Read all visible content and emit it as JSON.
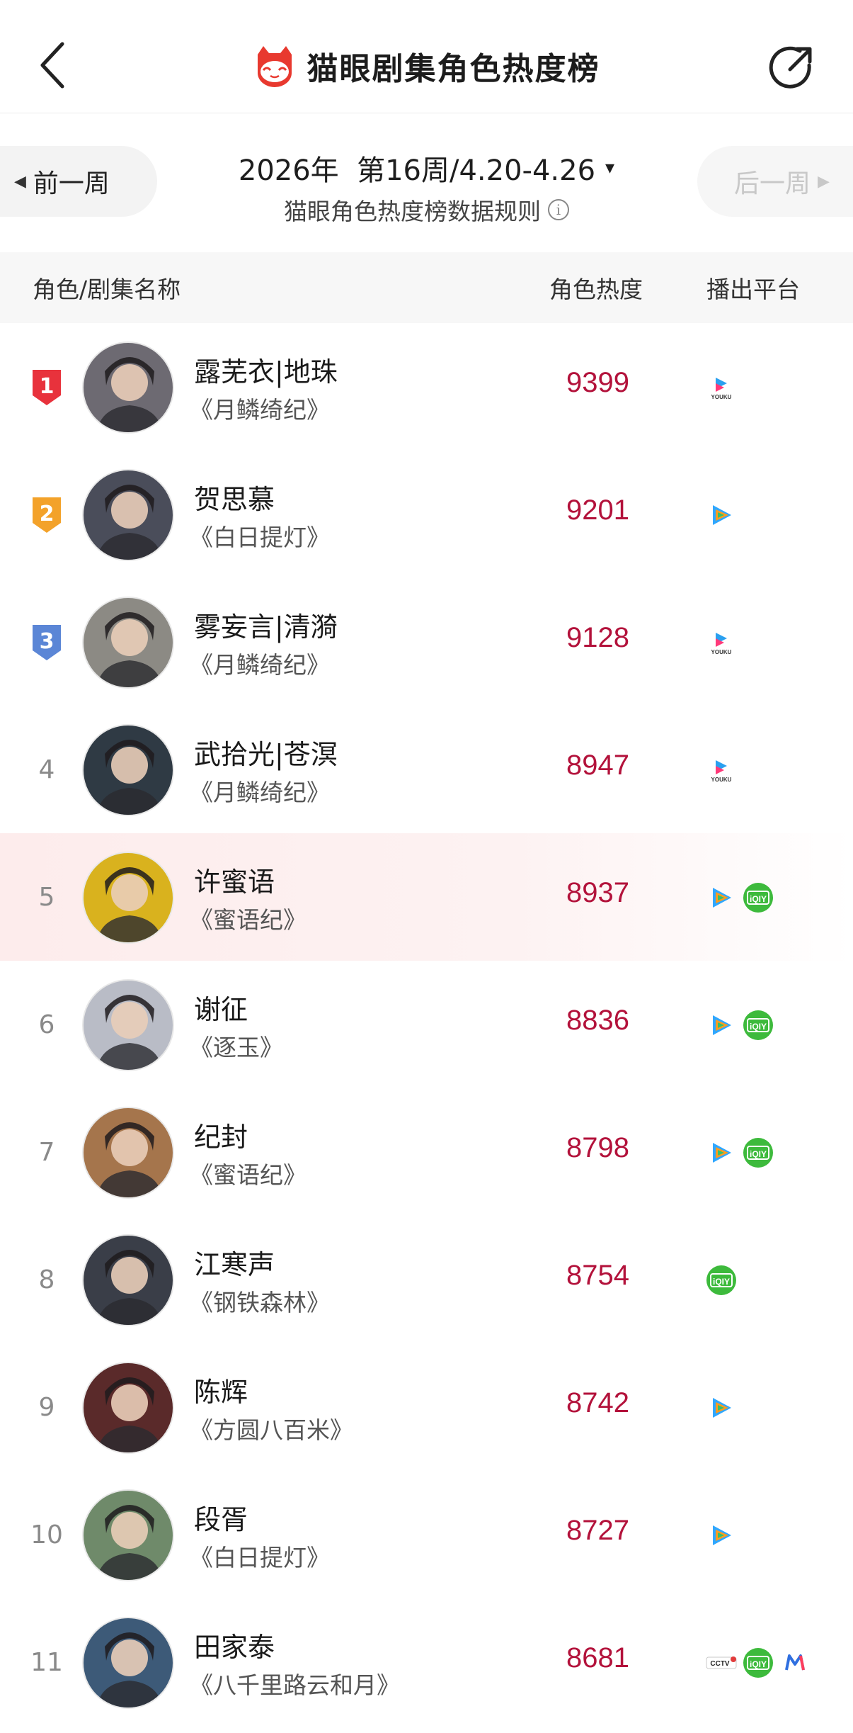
{
  "header": {
    "title": "猫眼剧集角色热度榜",
    "back_icon": "chevron-left-icon",
    "share_icon": "share-icon",
    "logo_icon": "maoyan-cat-logo"
  },
  "week_nav": {
    "prev_label": "前一周",
    "next_label": "后一周",
    "week_text": "2026年  第16周/4.20-4.26",
    "rules_text": "猫眼角色热度榜数据规则",
    "caret": "▾",
    "info": "i"
  },
  "table": {
    "col_name": "角色/剧集名称",
    "col_heat": "角色热度",
    "col_platform": "播出平台"
  },
  "colors": {
    "heat": "#b3123b",
    "rank1": "#e8323c",
    "rank2": "#f3a22a",
    "rank3": "#5b86d6",
    "highlight_row": "#fdecec"
  },
  "rows": [
    {
      "rank": "1",
      "name": "露芜衣|地珠",
      "show": "《月鳞绮纪》",
      "heat": "9399",
      "platforms": [
        "youku"
      ],
      "avatar_color": "#6d6a72"
    },
    {
      "rank": "2",
      "name": "贺思慕",
      "show": "《白日提灯》",
      "heat": "9201",
      "platforms": [
        "tencent"
      ],
      "avatar_color": "#4a4d5a"
    },
    {
      "rank": "3",
      "name": "雾妄言|清漪",
      "show": "《月鳞绮纪》",
      "heat": "9128",
      "platforms": [
        "youku"
      ],
      "avatar_color": "#8c8a84"
    },
    {
      "rank": "4",
      "name": "武拾光|苍溟",
      "show": "《月鳞绮纪》",
      "heat": "8947",
      "platforms": [
        "youku"
      ],
      "avatar_color": "#2f3a44"
    },
    {
      "rank": "5",
      "name": "许蜜语",
      "show": "《蜜语纪》",
      "heat": "8937",
      "platforms": [
        "tencent",
        "iqiyi"
      ],
      "avatar_color": "#d9b21e"
    },
    {
      "rank": "6",
      "name": "谢征",
      "show": "《逐玉》",
      "heat": "8836",
      "platforms": [
        "tencent",
        "iqiyi"
      ],
      "avatar_color": "#b9bcc6"
    },
    {
      "rank": "7",
      "name": "纪封",
      "show": "《蜜语纪》",
      "heat": "8798",
      "platforms": [
        "tencent",
        "iqiyi"
      ],
      "avatar_color": "#a5754c"
    },
    {
      "rank": "8",
      "name": "江寒声",
      "show": "《钢铁森林》",
      "heat": "8754",
      "platforms": [
        "iqiyi"
      ],
      "avatar_color": "#3a3e48"
    },
    {
      "rank": "9",
      "name": "陈辉",
      "show": "《方圆八百米》",
      "heat": "8742",
      "platforms": [
        "tencent"
      ],
      "avatar_color": "#5a2a2a"
    },
    {
      "rank": "10",
      "name": "段胥",
      "show": "《白日提灯》",
      "heat": "8727",
      "platforms": [
        "tencent"
      ],
      "avatar_color": "#6f8a6a"
    },
    {
      "rank": "11",
      "name": "田家泰",
      "show": "《八千里路云和月》",
      "heat": "8681",
      "platforms": [
        "cctv",
        "iqiyi",
        "mango"
      ],
      "avatar_color": "#3d5a78"
    }
  ]
}
